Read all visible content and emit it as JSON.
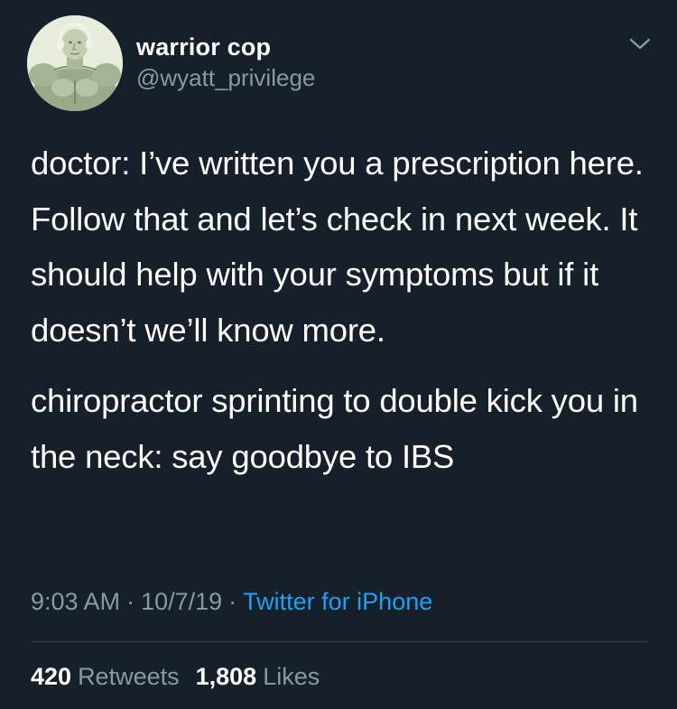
{
  "user": {
    "display_name": "warrior cop",
    "handle": "@wyatt_privilege",
    "avatar_icon": "washington-muscle-avatar"
  },
  "menu": {
    "icon": "chevron-down-icon",
    "color": "#8899a6"
  },
  "tweet": {
    "paragraphs": [
      "doctor: I’ve written you a prescription here. Follow that and let’s check in next week. It should help with your symptoms but if it doesn’t we’ll know more.",
      "chiropractor sprinting to double kick you in the neck: say goodbye to IBS"
    ]
  },
  "meta": {
    "time": "9:03 AM",
    "separator": "·",
    "date": "10/7/19",
    "source": "Twitter for iPhone"
  },
  "stats": {
    "retweets_count": "420",
    "retweets_label": "Retweets",
    "likes_count": "1,808",
    "likes_label": "Likes"
  },
  "colors": {
    "background": "#15202b",
    "text": "#ffffff",
    "secondary": "#8899a6",
    "link": "#1da1f2",
    "divider": "#38444d"
  }
}
